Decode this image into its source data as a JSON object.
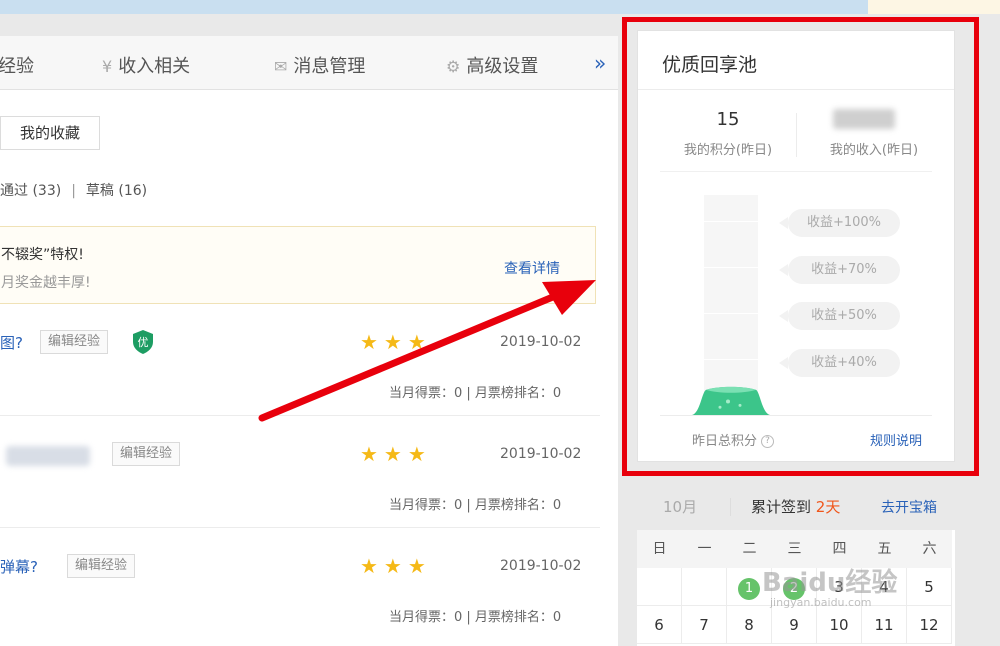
{
  "nav": {
    "items": [
      {
        "icon": "",
        "label": "经验"
      },
      {
        "icon": "yen-icon",
        "label": "收入相关"
      },
      {
        "icon": "mail-icon",
        "label": "消息管理"
      },
      {
        "icon": "gear-icon",
        "label": "高级设置"
      }
    ],
    "more": "»"
  },
  "main": {
    "favorites_button": "我的收藏",
    "filters": {
      "passed": "通过 (33)",
      "sep": "|",
      "drafts": "草稿 (16)"
    },
    "notice": {
      "line1": "不辍奖”特权!",
      "line2": "月奖金越丰厚!",
      "link": "查看详情"
    },
    "items": [
      {
        "title": "图?",
        "tag": "编辑经验",
        "badge": "优",
        "date": "2019-10-02",
        "votes": "当月得票：0 | 月票榜排名：0"
      },
      {
        "title": "",
        "tag": "编辑经验",
        "date": "2019-10-02",
        "votes": "当月得票：0 | 月票榜排名：0"
      },
      {
        "title": "弹幕?",
        "tag": "编辑经验",
        "date": "2019-10-02",
        "votes": "当月得票：0 | 月票榜排名：0"
      }
    ],
    "stars": "★★★"
  },
  "panel": {
    "title": "优质回享池",
    "score": "15",
    "score_label": "我的积分(昨日)",
    "income_label": "我的收入(昨日)",
    "gauge_level": 0.14,
    "bubbles": [
      "收益+100%",
      "收益+70%",
      "收益+50%",
      "收益+40%"
    ],
    "total_label": "昨日总积分",
    "help": "?",
    "rules": "规则说明"
  },
  "calendar": {
    "month": "10月",
    "cumulative_prefix": "累计签到",
    "cumulative_days": "2天",
    "open_box": "去开宝箱",
    "weekdays": [
      "日",
      "一",
      "二",
      "三",
      "四",
      "五",
      "六"
    ],
    "row1": [
      "",
      "",
      "1",
      "2",
      "3",
      "4",
      "5"
    ],
    "row2": [
      "6",
      "7",
      "8",
      "9",
      "10",
      "11",
      "12"
    ]
  },
  "watermark": {
    "text": "Baidu经验",
    "sub": "jingyan.baidu.com"
  },
  "colors": {
    "accent_red": "#e8000c",
    "link_blue": "#2a62b8",
    "star": "#f5b917",
    "gauge_green": "#3cc58a",
    "highlight_orange": "#f0561b"
  }
}
